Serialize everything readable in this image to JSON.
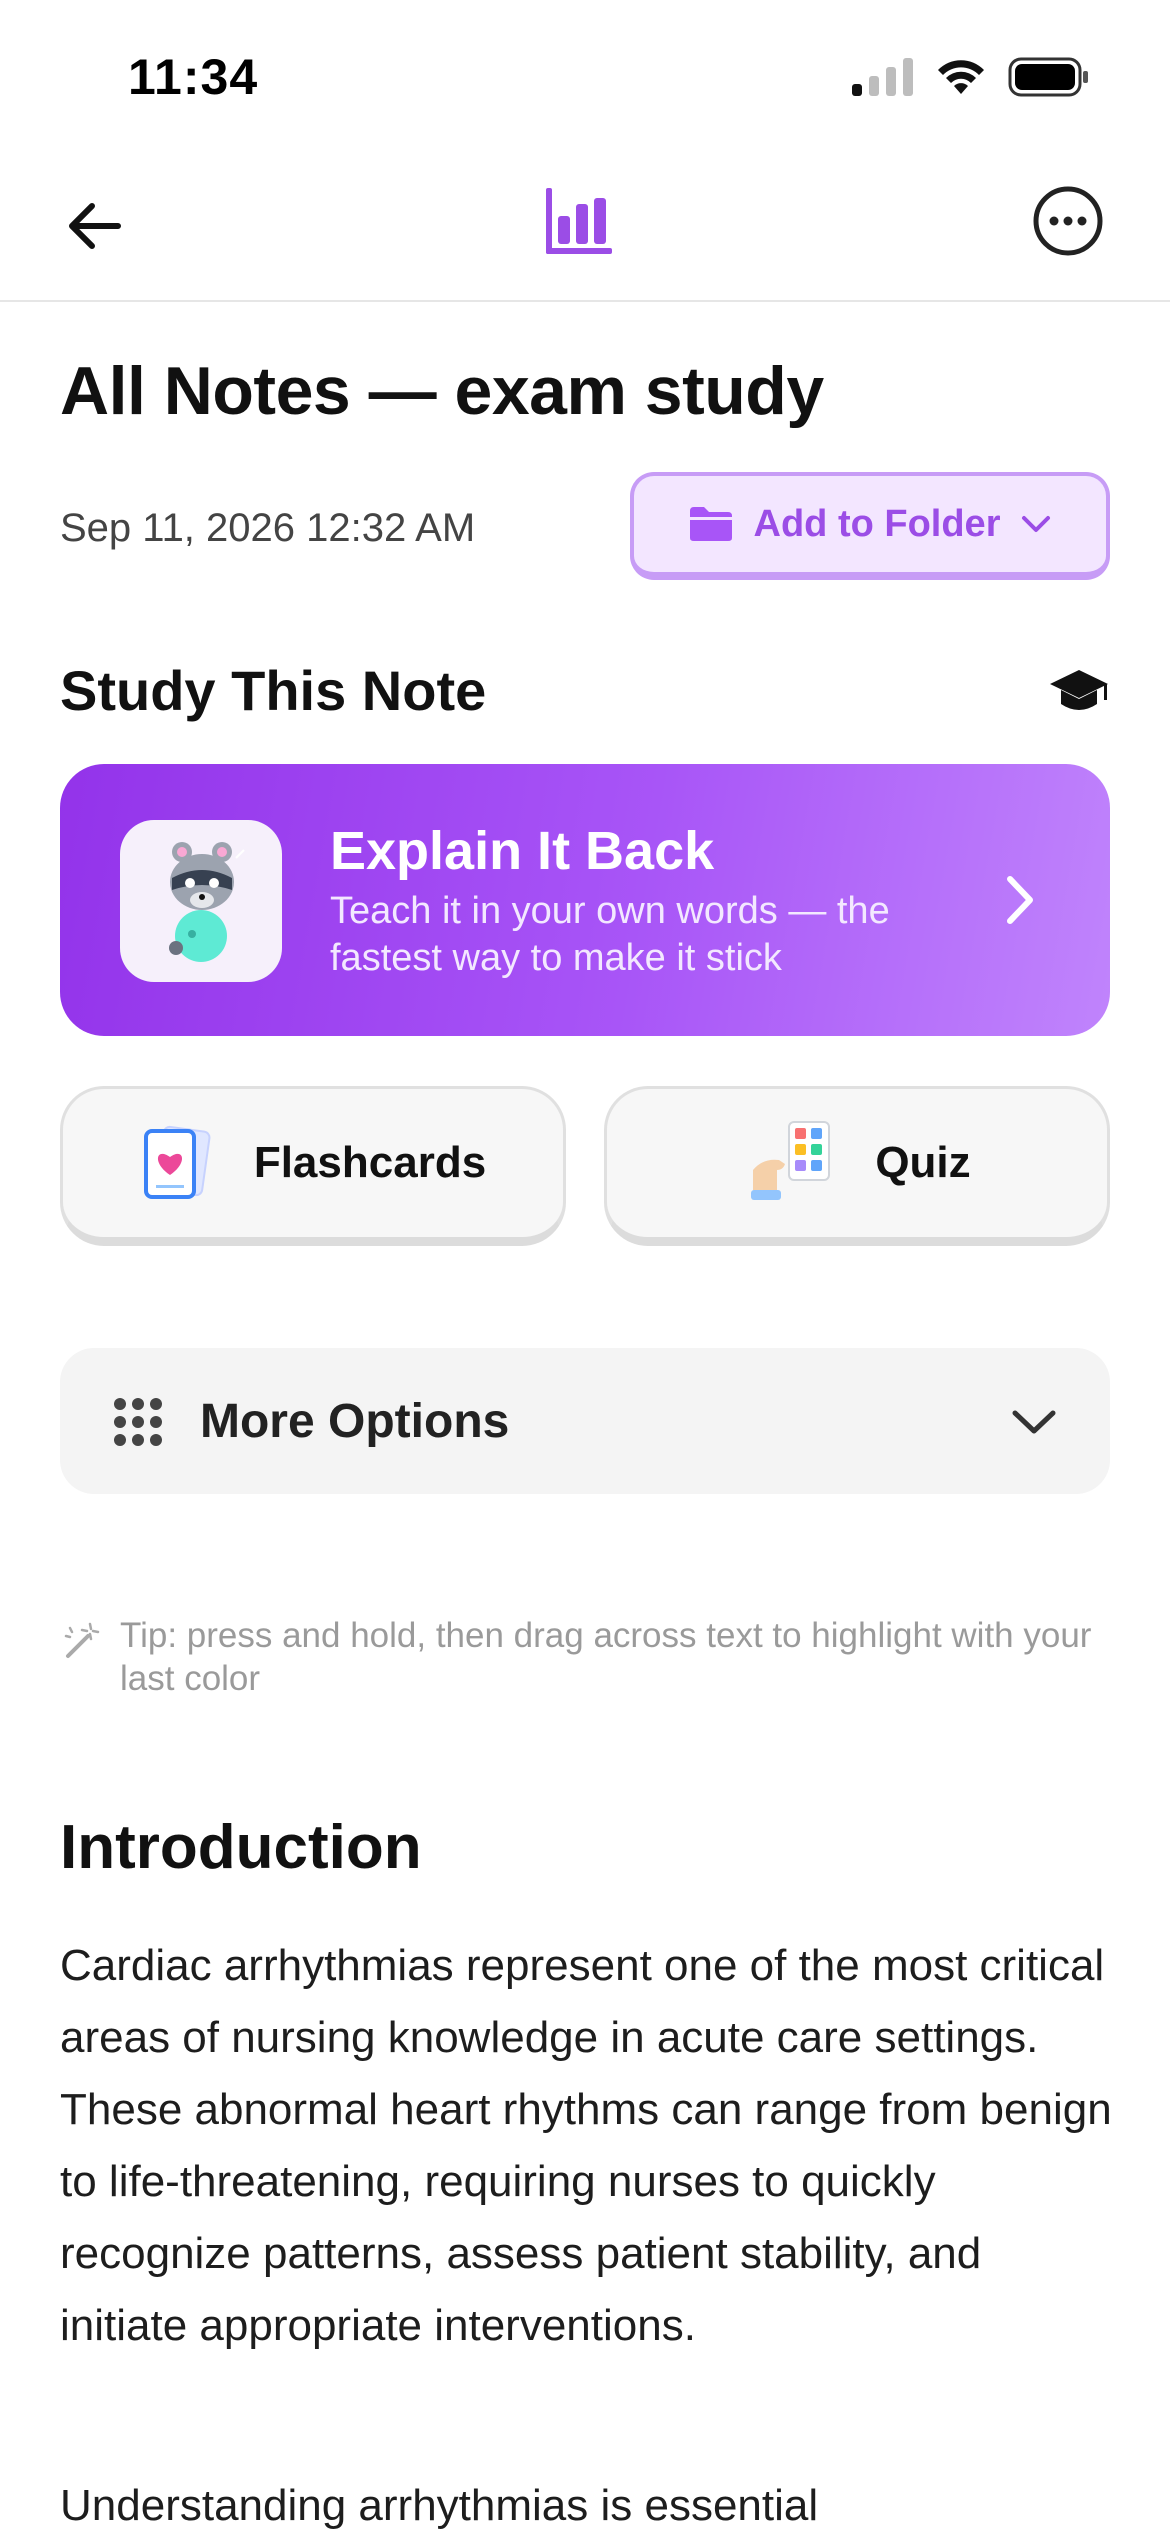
{
  "status_bar": {
    "time": "11:34"
  },
  "nav": {
    "back_icon": "arrow-left-icon",
    "center_icon": "bar-chart-icon",
    "more_icon": "ellipsis-circle-icon",
    "accent_color": "#9b4de6"
  },
  "note": {
    "title": "All Notes — exam study",
    "date": "Sep 11, 2026 12:32 AM",
    "add_to_folder_label": "Add to Folder"
  },
  "study": {
    "heading": "Study This Note",
    "explain_card": {
      "title": "Explain It Back",
      "subtitle": "Teach it in your own words — the fastest way to make it stick"
    },
    "modes": [
      {
        "label": "Flashcards",
        "icon": "flashcards-icon"
      },
      {
        "label": "Quiz",
        "icon": "quiz-icon"
      }
    ],
    "more_options_label": "More Options"
  },
  "tip": "Tip: press and hold, then drag across text to highlight with your last color",
  "content": {
    "section_heading": "Introduction",
    "paragraph_1": "Cardiac arrhythmias represent one of the most critical areas of nursing knowledge in acute care settings. These abnormal heart rhythms can range from benign to life-threatening, requiring nurses to quickly recognize patterns, assess patient stability, and initiate appropriate interventions.",
    "paragraph_2": "Understanding arrhythmias is essential"
  }
}
